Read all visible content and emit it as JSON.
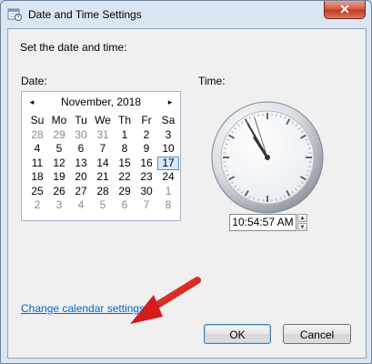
{
  "window": {
    "title": "Date and Time Settings",
    "close_label": "✕"
  },
  "content": {
    "instruction": "Set the date and time:",
    "date_label": "Date:",
    "time_label": "Time:"
  },
  "calendar": {
    "month_title": "November, 2018",
    "prev_icon": "◂",
    "next_icon": "▸",
    "weekdays": [
      "Su",
      "Mo",
      "Tu",
      "We",
      "Th",
      "Fr",
      "Sa"
    ],
    "weeks": [
      [
        {
          "d": "28",
          "other": true
        },
        {
          "d": "29",
          "other": true
        },
        {
          "d": "30",
          "other": true
        },
        {
          "d": "31",
          "other": true
        },
        {
          "d": "1"
        },
        {
          "d": "2"
        },
        {
          "d": "3"
        }
      ],
      [
        {
          "d": "4"
        },
        {
          "d": "5"
        },
        {
          "d": "6"
        },
        {
          "d": "7"
        },
        {
          "d": "8"
        },
        {
          "d": "9"
        },
        {
          "d": "10"
        }
      ],
      [
        {
          "d": "11"
        },
        {
          "d": "12"
        },
        {
          "d": "13"
        },
        {
          "d": "14"
        },
        {
          "d": "15"
        },
        {
          "d": "16"
        },
        {
          "d": "17",
          "selected": true
        }
      ],
      [
        {
          "d": "18"
        },
        {
          "d": "19"
        },
        {
          "d": "20"
        },
        {
          "d": "21"
        },
        {
          "d": "22"
        },
        {
          "d": "23"
        },
        {
          "d": "24"
        }
      ],
      [
        {
          "d": "25"
        },
        {
          "d": "26"
        },
        {
          "d": "27"
        },
        {
          "d": "28"
        },
        {
          "d": "29"
        },
        {
          "d": "30"
        },
        {
          "d": "1",
          "other": true
        }
      ],
      [
        {
          "d": "2",
          "other": true
        },
        {
          "d": "3",
          "other": true
        },
        {
          "d": "4",
          "other": true
        },
        {
          "d": "5",
          "other": true
        },
        {
          "d": "6",
          "other": true
        },
        {
          "d": "7",
          "other": true
        },
        {
          "d": "8",
          "other": true
        }
      ]
    ]
  },
  "clock": {
    "hours": 10,
    "minutes": 54,
    "seconds": 57
  },
  "time": {
    "value": "10:54:57 AM"
  },
  "link": {
    "label": "Change calendar settings"
  },
  "buttons": {
    "ok": "OK",
    "cancel": "Cancel"
  },
  "colors": {
    "link": "#0066cc",
    "arrow": "#e02020",
    "selected_day_border": "#5a8fc9"
  }
}
